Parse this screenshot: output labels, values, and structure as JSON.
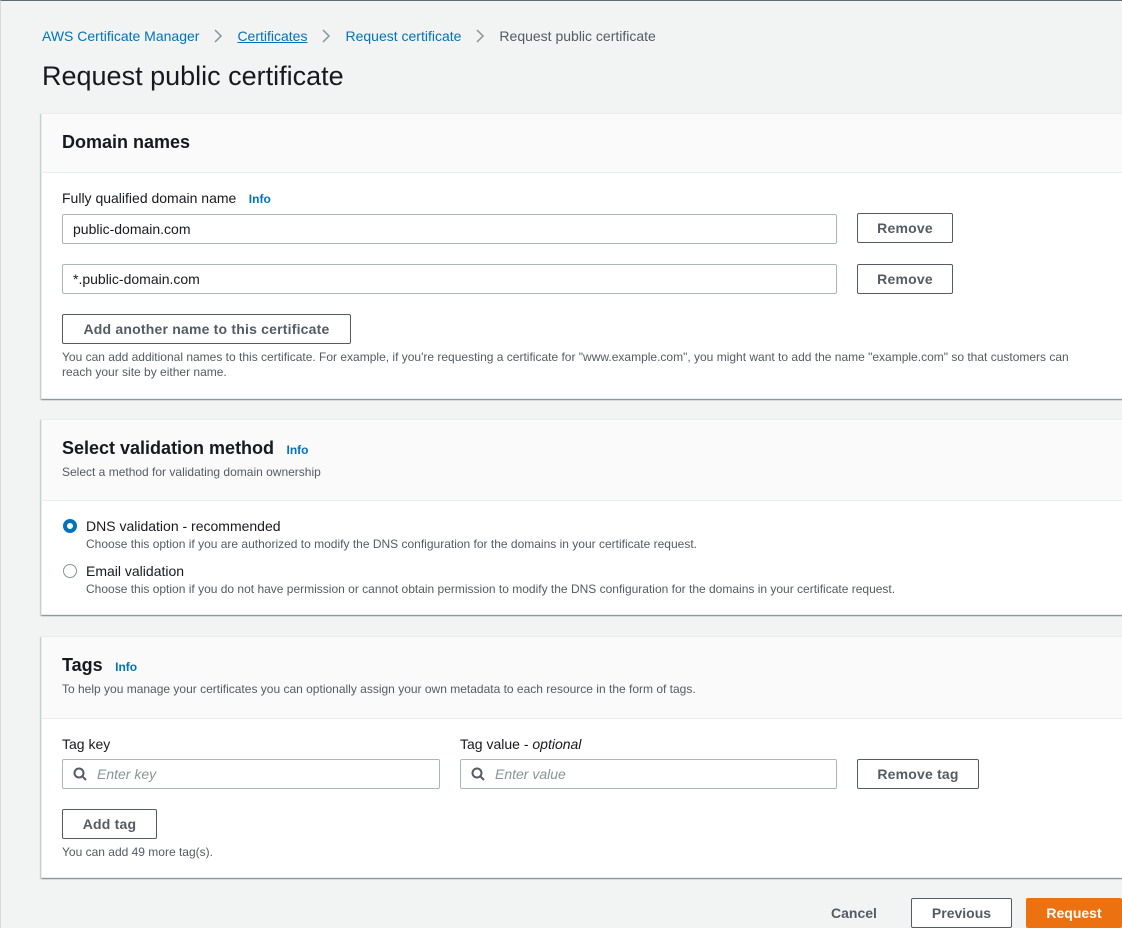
{
  "breadcrumb": {
    "items": [
      {
        "label": "AWS Certificate Manager"
      },
      {
        "label": "Certificates"
      },
      {
        "label": "Request certificate"
      },
      {
        "label": "Request public certificate"
      }
    ]
  },
  "page_title": "Request public certificate",
  "domain_names": {
    "title": "Domain names",
    "field_label": "Fully qualified domain name",
    "info_label": "Info",
    "domains": [
      {
        "value": "public-domain.com",
        "remove_label": "Remove"
      },
      {
        "value": "*.public-domain.com",
        "remove_label": "Remove"
      }
    ],
    "add_button_label": "Add another name to this certificate",
    "hint_line1": "You can add additional names to this certificate. For example, if you're requesting a certificate for \"www.example.com\", you might want to add the name \"example.com\" so that customers can",
    "hint_line2": "reach your site by either name."
  },
  "validation": {
    "title": "Select validation method",
    "info_label": "Info",
    "description": "Select a method for validating domain ownership",
    "options": [
      {
        "label": "DNS validation - recommended",
        "description": "Choose this option if you are authorized to modify the DNS configuration for the domains in your certificate request.",
        "selected": true
      },
      {
        "label": "Email validation",
        "description": "Choose this option if you do not have permission or cannot obtain permission to modify the DNS configuration for the domains in your certificate request.",
        "selected": false
      }
    ]
  },
  "tags": {
    "title": "Tags",
    "info_label": "Info",
    "description": "To help you manage your certificates you can optionally assign your own metadata to each resource in the form of tags.",
    "key_label": "Tag key",
    "value_label_prefix": "Tag value - ",
    "value_label_optional": "optional",
    "key_placeholder": "Enter key",
    "value_placeholder": "Enter value",
    "remove_tag_label": "Remove tag",
    "add_tag_label": "Add tag",
    "remaining_hint": "You can add 49 more tag(s)."
  },
  "footer": {
    "cancel_label": "Cancel",
    "previous_label": "Previous",
    "request_label": "Request"
  },
  "colors": {
    "link": "#0073bb",
    "primary_button": "#ec7211",
    "radio_selected": "#0073bb"
  }
}
